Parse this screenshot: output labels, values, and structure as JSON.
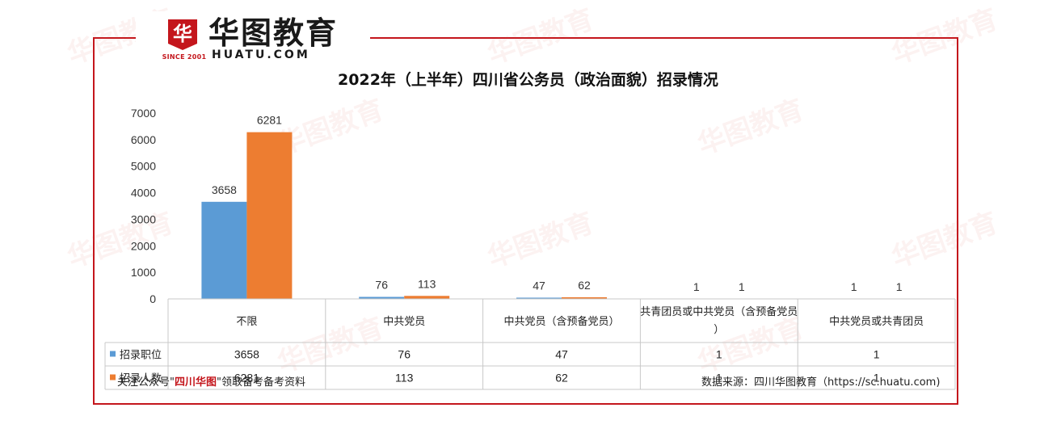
{
  "brand": {
    "name_cn": "华图教育",
    "name_en": "HUATU.COM",
    "since": "SINCE 2001",
    "mark": "华"
  },
  "colors": {
    "accent": "#c4161c",
    "series1": "#5b9bd5",
    "series2": "#ed7d31"
  },
  "chart_data": {
    "type": "bar",
    "title": "2022年（上半年）四川省公务员（政治面貌）招录情况",
    "categories": [
      "不限",
      "中共党员",
      "中共党员（含预备党员）",
      "共青团员或中共党员（含预备党员）",
      "中共党员或共青团员"
    ],
    "series": [
      {
        "name": "招录职位",
        "values": [
          3658,
          76,
          47,
          1,
          1
        ]
      },
      {
        "name": "招录人数",
        "values": [
          6281,
          113,
          62,
          1,
          1
        ]
      }
    ],
    "yticks": [
      "0",
      "1000",
      "2000",
      "3000",
      "4000",
      "5000",
      "6000",
      "7000"
    ],
    "ylim": [
      0,
      7000
    ],
    "legend": "data-table",
    "grid": false
  },
  "footer": {
    "left_prefix": "关注公众号\"",
    "left_highlight": "四川华图",
    "left_suffix": "\"领取备考备考资料",
    "right": "数据来源：四川华图教育（https://sc.huatu.com)"
  }
}
